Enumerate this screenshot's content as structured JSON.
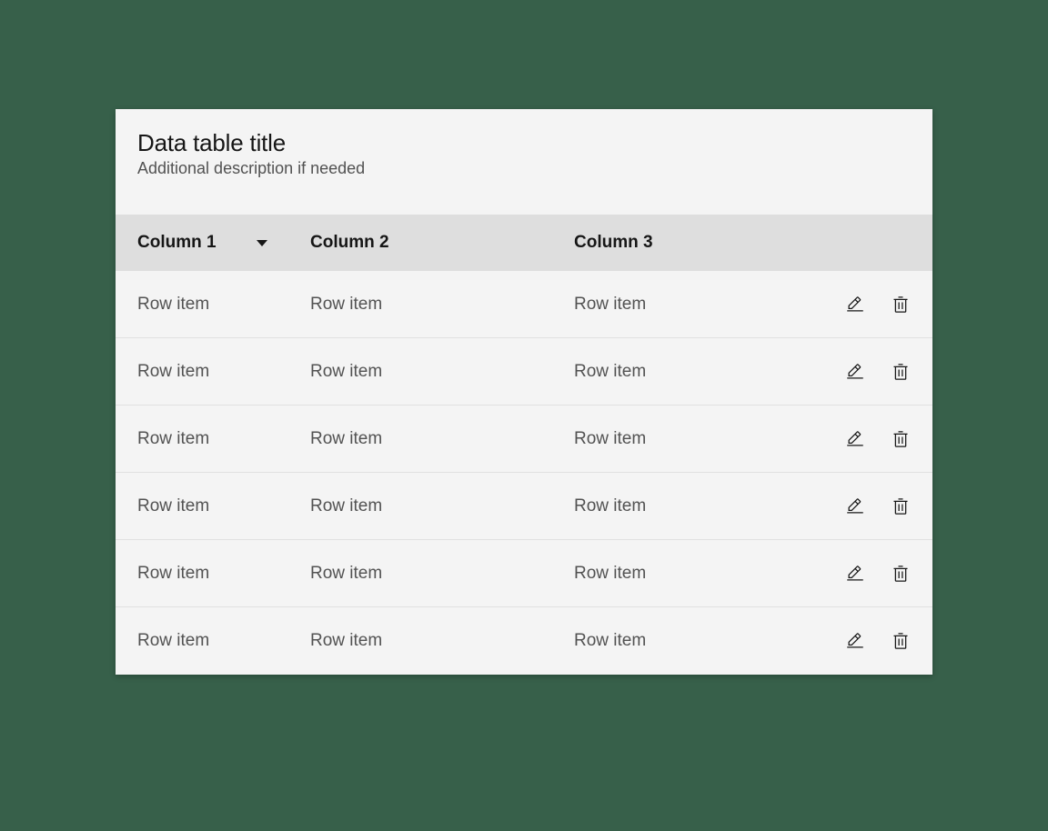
{
  "header": {
    "title": "Data table title",
    "subtitle": "Additional description if needed"
  },
  "columns": {
    "col1": "Column 1",
    "col2": "Column 2",
    "col3": "Column 3"
  },
  "rows": [
    {
      "col1": "Row item",
      "col2": "Row item",
      "col3": "Row item"
    },
    {
      "col1": "Row item",
      "col2": "Row item",
      "col3": "Row item"
    },
    {
      "col1": "Row item",
      "col2": "Row item",
      "col3": "Row item"
    },
    {
      "col1": "Row item",
      "col2": "Row item",
      "col3": "Row item"
    },
    {
      "col1": "Row item",
      "col2": "Row item",
      "col3": "Row item"
    },
    {
      "col1": "Row item",
      "col2": "Row item",
      "col3": "Row item"
    }
  ]
}
